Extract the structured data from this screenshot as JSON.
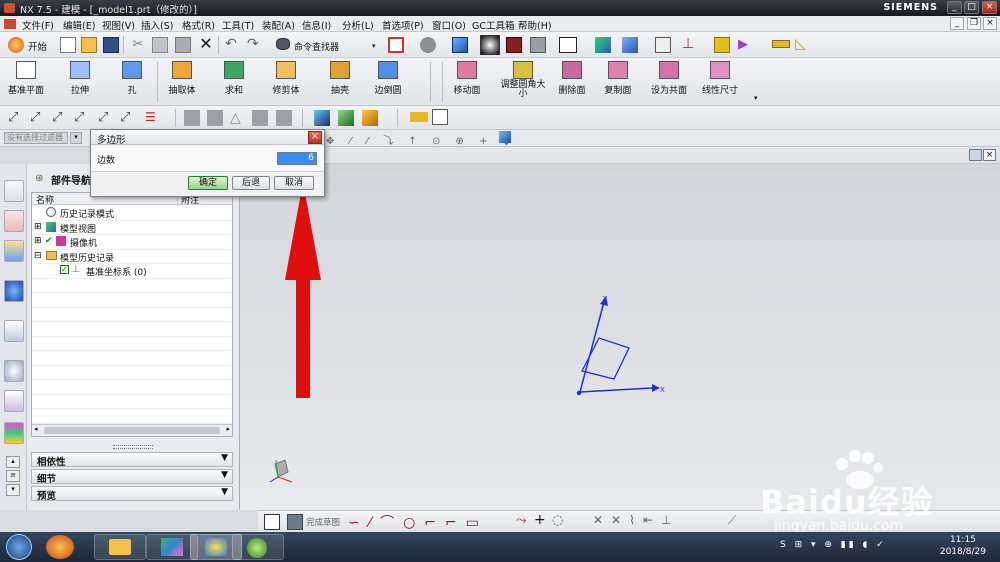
{
  "window": {
    "title": "NX 7.5 - 建模 - [_model1.prt（修改的）]",
    "brand": "SIEMENS"
  },
  "menus": [
    "文件(F)",
    "编辑(E)",
    "视图(V)",
    "插入(S)",
    "格式(R)",
    "工具(T)",
    "装配(A)",
    "信息(I)",
    "分析(L)",
    "首选项(P)",
    "窗口(O)",
    "GC工具箱",
    "帮助(H)"
  ],
  "toolbar1": {
    "start_label": "开始",
    "command_finder_label": "命令查找器"
  },
  "toolbar2": {
    "items": [
      "基准平面",
      "拉伸",
      "孔",
      "抽取体",
      "求和",
      "修剪体",
      "抽壳",
      "边倒圆",
      "移动面",
      "调整圆角大小",
      "删除面",
      "复制面",
      "设为共面",
      "线性尺寸"
    ]
  },
  "selection_filter": {
    "value": "没有选择过滤器"
  },
  "nav": {
    "title": "部件导航器",
    "col_name": "名称",
    "col_note": "附注",
    "rows": [
      "历史记录模式",
      "模型视图",
      "摄像机",
      "模型历史记录",
      "基准坐标系 (0)"
    ],
    "sections": [
      "相依性",
      "细节",
      "预览"
    ]
  },
  "dialog": {
    "title": "多边形",
    "field_label": "边数",
    "field_value": "6",
    "ok": "确定",
    "back": "后退",
    "cancel": "取消"
  },
  "sketch_bar": {
    "finish_label": "完成草图"
  },
  "axes": {
    "x": "X",
    "y": "Y"
  },
  "taskbar": {
    "time": "11:15",
    "date": "2018/8/29"
  },
  "watermark": {
    "text": "Baidu经验",
    "url": "jingyan.baidu.com"
  },
  "colors": {
    "accent": "#3b8bf5",
    "arrow": "#e00f0f",
    "axis": "#1f2fd6"
  }
}
